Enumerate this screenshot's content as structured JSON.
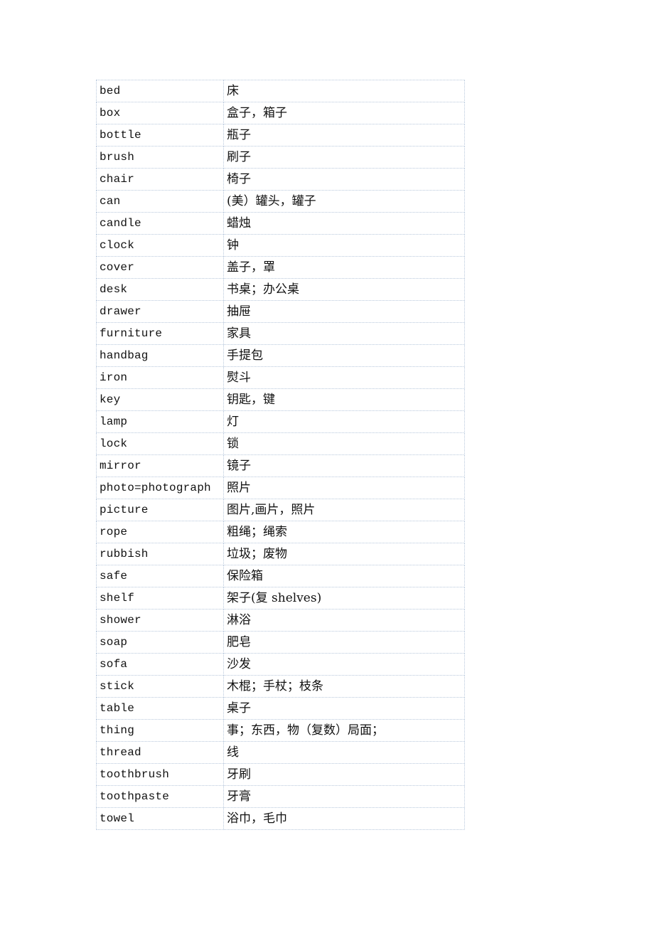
{
  "vocabulary": {
    "rows": [
      {
        "en": "bed",
        "zh": "床"
      },
      {
        "en": "box",
        "zh": "盒子，箱子"
      },
      {
        "en": "bottle",
        "zh": "瓶子"
      },
      {
        "en": "brush",
        "zh": "刷子"
      },
      {
        "en": "chair",
        "zh": "椅子"
      },
      {
        "en": "can",
        "zh": "(美）罐头，罐子"
      },
      {
        "en": "candle",
        "zh": "蜡烛"
      },
      {
        "en": "clock",
        "zh": "钟"
      },
      {
        "en": "cover",
        "zh": "盖子，罩"
      },
      {
        "en": "desk",
        "zh": "书桌；办公桌"
      },
      {
        "en": "drawer",
        "zh": "抽屉"
      },
      {
        "en": "furniture",
        "zh": "家具"
      },
      {
        "en": "handbag",
        "zh": "手提包"
      },
      {
        "en": "iron",
        "zh": "熨斗"
      },
      {
        "en": "key",
        "zh": "钥匙，键"
      },
      {
        "en": "lamp",
        "zh": "灯"
      },
      {
        "en": "lock",
        "zh": "锁"
      },
      {
        "en": "mirror",
        "zh": "镜子"
      },
      {
        "en": "photo=photograph",
        "zh": "照片"
      },
      {
        "en": "picture",
        "zh": "图片,画片，照片"
      },
      {
        "en": "rope",
        "zh": "粗绳；绳索"
      },
      {
        "en": "rubbish",
        "zh": "垃圾；废物"
      },
      {
        "en": "safe",
        "zh": "保险箱"
      },
      {
        "en": "shelf",
        "zh": "架子(复 shelves)"
      },
      {
        "en": "shower",
        "zh": "淋浴"
      },
      {
        "en": "soap",
        "zh": "肥皂"
      },
      {
        "en": "sofa",
        "zh": "沙发"
      },
      {
        "en": "stick",
        "zh": "木棍；手杖；枝条"
      },
      {
        "en": "table",
        "zh": "桌子"
      },
      {
        "en": "thing",
        "zh": "事；东西，物（复数）局面；"
      },
      {
        "en": "thread",
        "zh": "线"
      },
      {
        "en": "toothbrush",
        "zh": "牙刷"
      },
      {
        "en": "toothpaste",
        "zh": "牙膏"
      },
      {
        "en": "towel",
        "zh": "浴巾，毛巾"
      }
    ]
  }
}
